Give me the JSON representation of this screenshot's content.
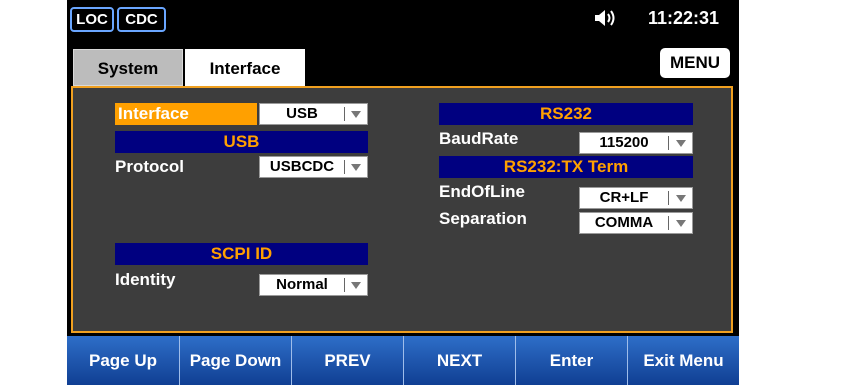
{
  "status": {
    "loc_badge": "LOC",
    "cdc_badge": "CDC",
    "time": "11:22:31",
    "speaker_icon": "speaker-icon"
  },
  "tabs": [
    {
      "label": "System"
    },
    {
      "label": "Interface"
    }
  ],
  "menu_label": "MENU",
  "left": {
    "interface_label": "Interface",
    "interface_value": "USB",
    "usb_header": "USB",
    "protocol_label": "Protocol",
    "protocol_value": "USBCDC",
    "scpi_header": "SCPI ID",
    "identity_label": "Identity",
    "identity_value": "Normal"
  },
  "right": {
    "rs232_header": "RS232",
    "baudrate_label": "BaudRate",
    "baudrate_value": "115200",
    "txterm_header": "RS232:TX Term",
    "eol_label": "EndOfLine",
    "eol_value": "CR+LF",
    "separation_label": "Separation",
    "separation_value": "COMMA"
  },
  "softkeys": [
    "Page Up",
    "Page Down",
    "PREV",
    "NEXT",
    "Enter",
    "Exit Menu"
  ],
  "colors": {
    "accent": "#ffa000",
    "header_bg": "#000080",
    "panel_bg": "#3d3d3d",
    "softkey": "#1f56ad"
  }
}
